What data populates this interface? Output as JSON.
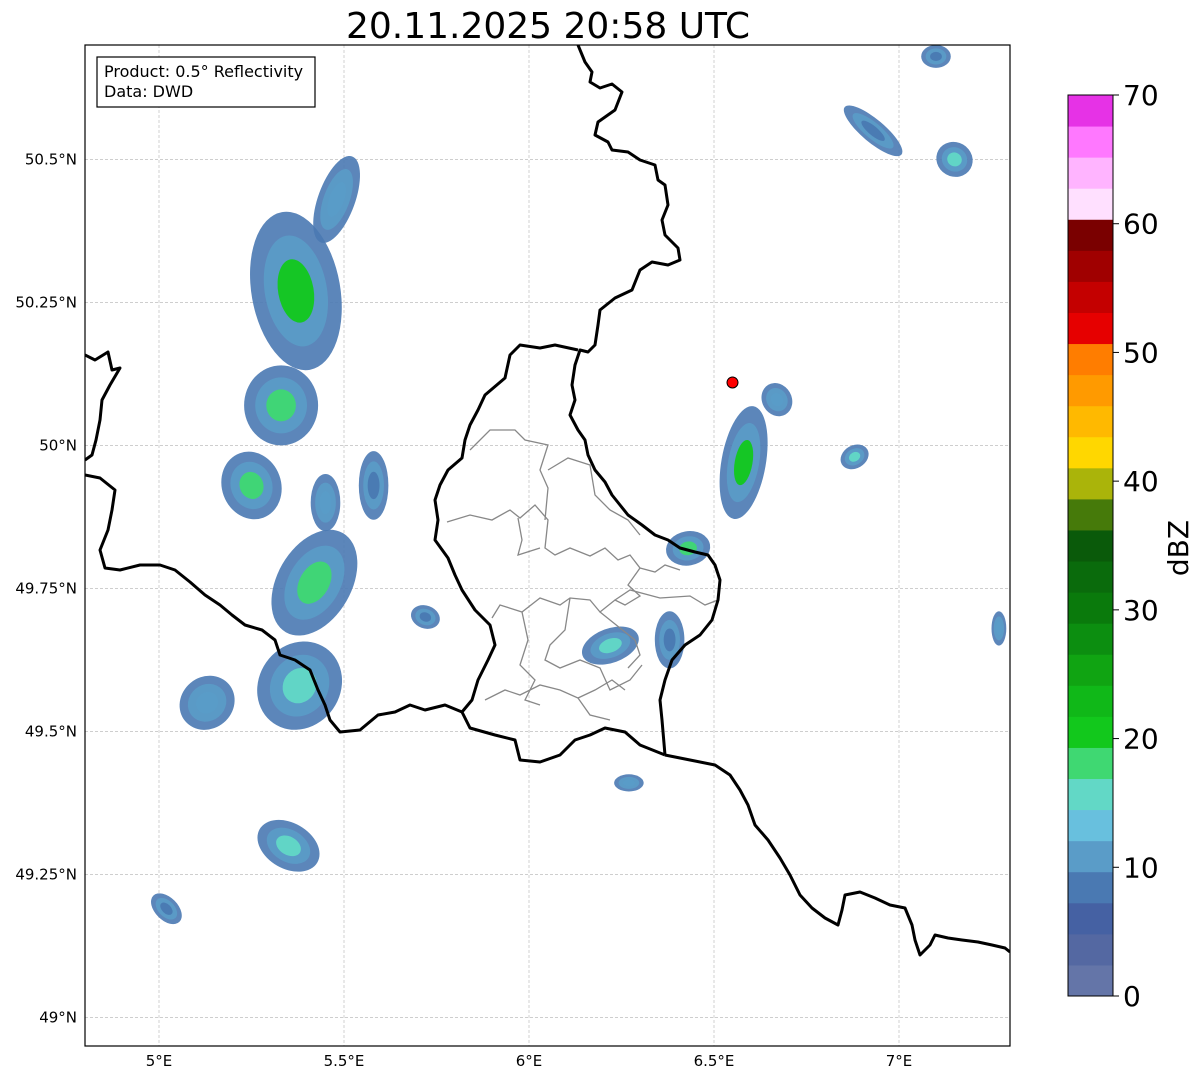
{
  "title": "20.11.2025 20:58 UTC",
  "info_box": {
    "line1": "Product: 0.5° Reflectivity",
    "line2": "Data: DWD"
  },
  "map": {
    "lon_range": [
      4.8,
      7.3
    ],
    "lat_range": [
      48.95,
      50.7
    ],
    "lon_ticks": [
      {
        "value": 5.0,
        "label": "5°E"
      },
      {
        "value": 5.5,
        "label": "5.5°E"
      },
      {
        "value": 6.0,
        "label": "6°E"
      },
      {
        "value": 6.5,
        "label": "6.5°E"
      },
      {
        "value": 7.0,
        "label": "7°E"
      }
    ],
    "lat_ticks": [
      {
        "value": 49.0,
        "label": "49°N"
      },
      {
        "value": 49.25,
        "label": "49.25°N"
      },
      {
        "value": 49.5,
        "label": "49.5°N"
      },
      {
        "value": 49.75,
        "label": "49.75°N"
      },
      {
        "value": 50.0,
        "label": "50°N"
      },
      {
        "value": 50.25,
        "label": "50.25°N"
      },
      {
        "value": 50.5,
        "label": "50.5°N"
      }
    ],
    "grid": true,
    "radar_site": {
      "lon": 6.55,
      "lat": 50.11,
      "color": "#ff0000"
    }
  },
  "colorbar": {
    "label": "dBZ",
    "min": 0,
    "max": 70,
    "ticks": [
      {
        "value": 0,
        "label": "0"
      },
      {
        "value": 10,
        "label": "10"
      },
      {
        "value": 20,
        "label": "20"
      },
      {
        "value": 30,
        "label": "30"
      },
      {
        "value": 40,
        "label": "40"
      },
      {
        "value": 50,
        "label": "50"
      },
      {
        "value": 60,
        "label": "60"
      },
      {
        "value": 70,
        "label": "70"
      }
    ],
    "colors": [
      "#6475a8",
      "#5468a2",
      "#4561a3",
      "#4a79b2",
      "#5a9cc8",
      "#68c0de",
      "#62d8c6",
      "#3fd872",
      "#12c81c",
      "#10b818",
      "#10a412",
      "#0c8e10",
      "#0a7a0c",
      "#0a6b0c",
      "#0a5a0a",
      "#467a0a",
      "#aab40a",
      "#ffd700",
      "#ffb900",
      "#ff9a00",
      "#ff7d00",
      "#e60000",
      "#c40000",
      "#a00000",
      "#7a0000",
      "#ffe0ff",
      "#ffb4ff",
      "#ff78ff",
      "#e632e6"
    ]
  },
  "echo_cells": [
    {
      "lon": 5.37,
      "lat": 50.27,
      "rx": 0.12,
      "ry": 0.14,
      "rot": -10,
      "peak": "#12c81c"
    },
    {
      "lon": 5.48,
      "lat": 50.43,
      "rx": 0.05,
      "ry": 0.08,
      "rot": 20,
      "peak": "#5a9cc8"
    },
    {
      "lon": 5.33,
      "lat": 50.07,
      "rx": 0.1,
      "ry": 0.07,
      "rot": 0,
      "peak": "#3fd872"
    },
    {
      "lon": 5.25,
      "lat": 49.93,
      "rx": 0.08,
      "ry": 0.06,
      "rot": -20,
      "peak": "#3fd872"
    },
    {
      "lon": 5.45,
      "lat": 49.9,
      "rx": 0.04,
      "ry": 0.05,
      "rot": 0,
      "peak": "#5a9cc8"
    },
    {
      "lon": 5.42,
      "lat": 49.76,
      "rx": 0.1,
      "ry": 0.1,
      "rot": 30,
      "peak": "#3fd872"
    },
    {
      "lon": 5.38,
      "lat": 49.58,
      "rx": 0.11,
      "ry": 0.08,
      "rot": 35,
      "peak": "#62d8c6"
    },
    {
      "lon": 5.13,
      "lat": 49.55,
      "rx": 0.07,
      "ry": 0.05,
      "rot": 50,
      "peak": "#5a9cc8"
    },
    {
      "lon": 5.35,
      "lat": 49.3,
      "rx": 0.09,
      "ry": 0.04,
      "rot": 30,
      "peak": "#62d8c6"
    },
    {
      "lon": 5.02,
      "lat": 49.19,
      "rx": 0.05,
      "ry": 0.02,
      "rot": 45,
      "peak": "#4a79b2"
    },
    {
      "lon": 5.58,
      "lat": 49.93,
      "rx": 0.04,
      "ry": 0.06,
      "rot": 0,
      "peak": "#4a79b2"
    },
    {
      "lon": 5.72,
      "lat": 49.7,
      "rx": 0.04,
      "ry": 0.02,
      "rot": 20,
      "peak": "#4a79b2"
    },
    {
      "lon": 6.58,
      "lat": 49.97,
      "rx": 0.06,
      "ry": 0.1,
      "rot": 10,
      "peak": "#12c81c"
    },
    {
      "lon": 6.43,
      "lat": 49.82,
      "rx": 0.06,
      "ry": 0.03,
      "rot": -10,
      "peak": "#3fd872"
    },
    {
      "lon": 6.22,
      "lat": 49.65,
      "rx": 0.08,
      "ry": 0.03,
      "rot": -20,
      "peak": "#62d8c6"
    },
    {
      "lon": 6.38,
      "lat": 49.66,
      "rx": 0.04,
      "ry": 0.05,
      "rot": 0,
      "peak": "#4a79b2"
    },
    {
      "lon": 6.88,
      "lat": 49.98,
      "rx": 0.04,
      "ry": 0.02,
      "rot": -30,
      "peak": "#62d8c6"
    },
    {
      "lon": 7.15,
      "lat": 50.5,
      "rx": 0.05,
      "ry": 0.03,
      "rot": 30,
      "peak": "#62d8c6"
    },
    {
      "lon": 6.93,
      "lat": 50.55,
      "rx": 0.1,
      "ry": 0.02,
      "rot": 40,
      "peak": "#4a79b2"
    },
    {
      "lon": 7.1,
      "lat": 50.68,
      "rx": 0.04,
      "ry": 0.02,
      "rot": 0,
      "peak": "#4a79b2"
    },
    {
      "lon": 6.27,
      "lat": 49.41,
      "rx": 0.04,
      "ry": 0.015,
      "rot": 0,
      "peak": "#5a9cc8"
    },
    {
      "lon": 6.67,
      "lat": 50.08,
      "rx": 0.04,
      "ry": 0.03,
      "rot": -30,
      "peak": "#5a9cc8"
    },
    {
      "lon": 7.27,
      "lat": 49.68,
      "rx": 0.02,
      "ry": 0.03,
      "rot": 0,
      "peak": "#5a9cc8"
    }
  ]
}
